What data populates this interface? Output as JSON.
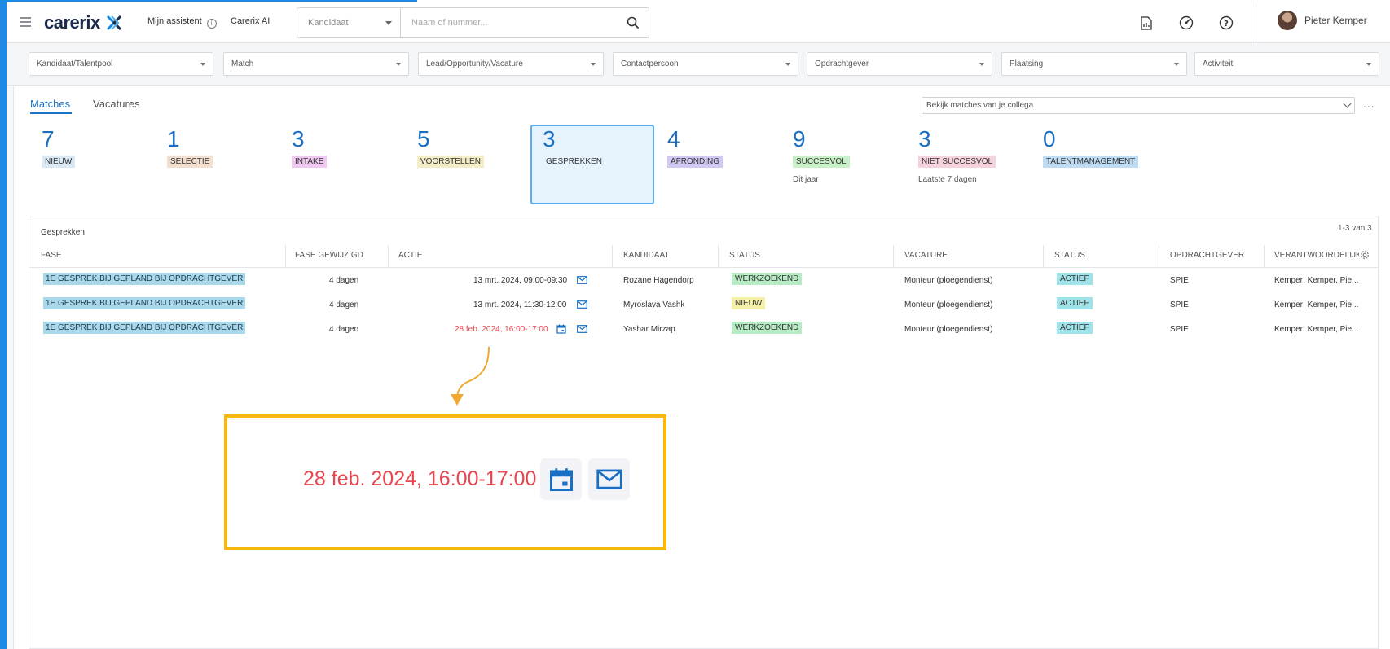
{
  "header": {
    "logo": "carerix",
    "assistant_label": "Mijn assistent",
    "ai_label": "Carerix AI",
    "search_type": "Kandidaat",
    "search_placeholder": "Naam of nummer...",
    "user_name": "Pieter Kemper"
  },
  "filters": [
    "Kandidaat/Talentpool",
    "Match",
    "Lead/Opportunity/Vacature",
    "Contactpersoon",
    "Opdrachtgever",
    "Plaatsing",
    "Activiteit"
  ],
  "tabs": {
    "matches": "Matches",
    "vacatures": "Vacatures"
  },
  "colleague_select": "Bekijk matches van je collega",
  "more": "...",
  "stats": [
    {
      "count": "7",
      "label": "NIEUW",
      "color": "#dbe9f5",
      "sub": ""
    },
    {
      "count": "1",
      "label": "SELECTIE",
      "color": "#f3dfcf",
      "sub": ""
    },
    {
      "count": "3",
      "label": "INTAKE",
      "color": "#efc9ef",
      "sub": ""
    },
    {
      "count": "5",
      "label": "VOORSTELLEN",
      "color": "#f3ecc9",
      "sub": ""
    },
    {
      "count": "3",
      "label": "GESPREKKEN",
      "color": "#e6f2fc",
      "sub": ""
    },
    {
      "count": "4",
      "label": "AFRONDING",
      "color": "#d2c9f3",
      "sub": ""
    },
    {
      "count": "9",
      "label": "SUCCESVOL",
      "color": "#c9f0c9",
      "sub": "Dit jaar"
    },
    {
      "count": "3",
      "label": "NIET SUCCESVOL",
      "color": "#f5d3dc",
      "sub": "Laatste 7 dagen"
    },
    {
      "count": "0",
      "label": "TALENTMANAGEMENT",
      "color": "#bfdcf2",
      "sub": ""
    }
  ],
  "table": {
    "title": "Gesprekken",
    "count": "1-3 van 3",
    "columns": [
      "FASE",
      "FASE GEWIJZIGD",
      "ACTIE",
      "KANDIDAAT",
      "STATUS",
      "VACATURE",
      "STATUS",
      "OPDRACHTGEVER",
      "VERANTWOORDELIJKE"
    ],
    "rows": [
      {
        "fase": "1E GESPREK BIJ GEPLAND BIJ OPDRACHTGEVER",
        "gewijzigd": "4 dagen",
        "actie": "13 mrt. 2024, 09:00-09:30",
        "kandidaat": "Rozane Hagendorp",
        "status": "WERKZOEKEND",
        "status_color": "#b6ecc4",
        "vacature": "Monteur (ploegendienst)",
        "vac_status": "ACTIEF",
        "opdrachtgever": "SPIE",
        "verantwoordelijke": "Kemper: Kemper, Pie..."
      },
      {
        "fase": "1E GESPREK BIJ GEPLAND BIJ OPDRACHTGEVER",
        "gewijzigd": "4 dagen",
        "actie": "13 mrt. 2024, 11:30-12:00",
        "kandidaat": "Myroslava Vashk",
        "status": "NIEUW",
        "status_color": "#f5f0a8",
        "vacature": "Monteur (ploegendienst)",
        "vac_status": "ACTIEF",
        "opdrachtgever": "SPIE",
        "verantwoordelijke": "Kemper: Kemper, Pie..."
      },
      {
        "fase": "1E GESPREK BIJ GEPLAND BIJ OPDRACHTGEVER",
        "gewijzigd": "4 dagen",
        "actie": "28 feb. 2024, 16:00-17:00",
        "kandidaat": "Yashar Mirzap",
        "status": "WERKZOEKEND",
        "status_color": "#b6ecc4",
        "vacature": "Monteur (ploegendienst)",
        "vac_status": "ACTIEF",
        "opdrachtgever": "SPIE",
        "verantwoordelijke": "Kemper: Kemper, Pie..."
      }
    ]
  },
  "callout": {
    "text": "28 feb. 2024, 16:00-17:00"
  },
  "colors": {
    "accent": "#1a73c9",
    "overdue": "#e8454e",
    "highlight": "#f6b80f",
    "vacancy_active": "#9fe3ea"
  }
}
